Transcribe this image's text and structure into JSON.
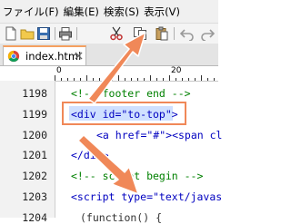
{
  "menu": [
    "ファイル(F)",
    "編集(E)",
    "検索(S)",
    "表示(V)"
  ],
  "tab": {
    "label": "index.html"
  },
  "ruler": [
    "0",
    "20"
  ],
  "lines": [
    {
      "number": "1198",
      "text": "<!-- footer end -->"
    },
    {
      "number": "1199",
      "text": "<div id=\"to-top\">"
    },
    {
      "number": "1200",
      "text": "<a href=\"#\"><span cl"
    },
    {
      "number": "1201",
      "text": "</div>"
    },
    {
      "number": "1202",
      "text": "<!-- script begin -->"
    },
    {
      "number": "1203",
      "text": "<script type=\"text/javas"
    },
    {
      "number": "1204",
      "text": "(function() {"
    }
  ],
  "colors": {
    "arrow": "#f08858",
    "selection": "#cfe0ff",
    "comment": "#008000",
    "tag": "#0000c0",
    "attribute": "#c00000"
  },
  "icons": [
    "new-file-icon",
    "open-folder-icon",
    "save-icon",
    "print-icon",
    "cut-icon",
    "copy-icon",
    "paste-icon",
    "undo-icon",
    "redo-icon",
    "chrome-icon",
    "close-icon"
  ]
}
